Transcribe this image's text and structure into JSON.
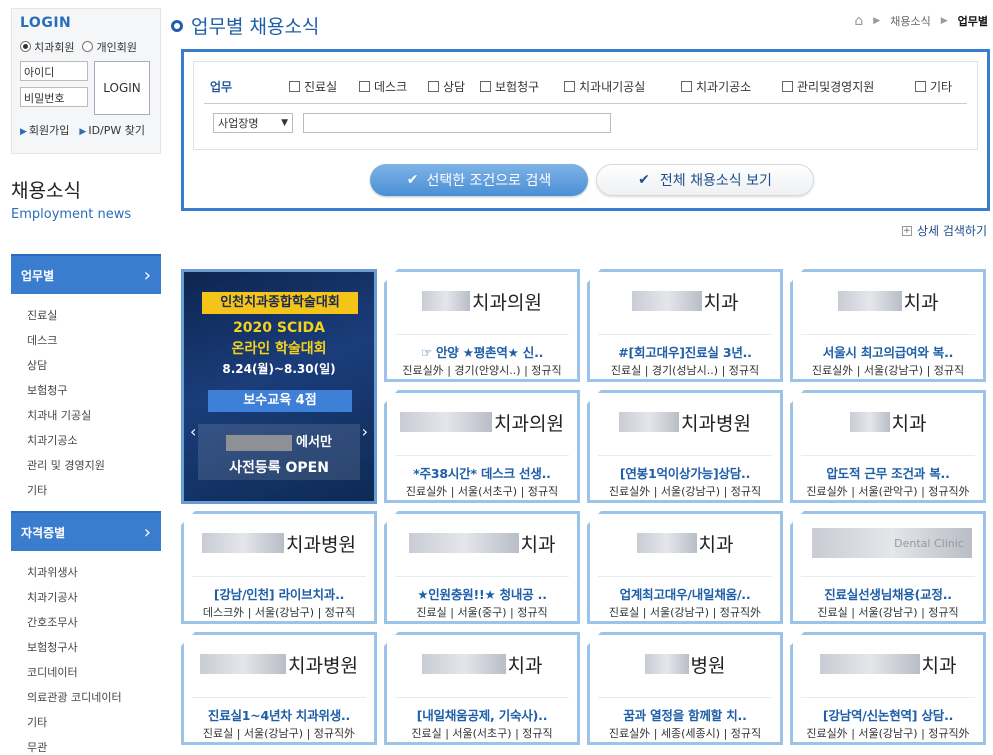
{
  "sidebar": {
    "login_title": "LOGIN",
    "radio_member_dental": "치과회원",
    "radio_member_personal": "개인회원",
    "id_placeholder": "아이디",
    "pw_placeholder": "비밀번호",
    "login_button": "LOGIN",
    "signup_link": "회원가입",
    "find_link": "ID/PW 찾기",
    "section_title": "채용소식",
    "section_subtitle": "Employment news",
    "cat_job_head": "업무별",
    "cat_job_items": [
      "진료실",
      "데스크",
      "상담",
      "보험청구",
      "치과내 기공실",
      "치과기공소",
      "관리 및 경영지원",
      "기타"
    ],
    "cat_license_head": "자격증별",
    "cat_license_items": [
      "치과위생사",
      "치과기공사",
      "간호조무사",
      "보험청구사",
      "코디네이터",
      "의료관광 코디네이터",
      "기타",
      "무관"
    ]
  },
  "header": {
    "title": "업무별 채용소식",
    "breadcrumb": [
      "채용소식",
      "업무별"
    ]
  },
  "search": {
    "job_label": "업무",
    "job_options": [
      "진료실",
      "데스크",
      "상담",
      "보험청구",
      "치과내기공실",
      "치과기공소",
      "관리및경영지원",
      "기타"
    ],
    "select_value": "사업장명",
    "search_button": "선택한 조건으로 검색",
    "all_button": "전체 채용소식 보기",
    "detail_link": "상세 검색하기"
  },
  "banner": {
    "top_label": "인천치과종합학술대회",
    "line1": "2020 SCIDA",
    "line2": "온라인 학술대회",
    "dates": "8.24(월)~8.30(일)",
    "edu": "보수교육 4점",
    "reg_suffix": "에서만",
    "reg_line2": "사전등록 OPEN"
  },
  "cards": [
    {
      "logo_text": "치과의원",
      "title": "☞ 안양 ★평촌역★ 신..",
      "meta": "진료실外 | 경기(안양시..) | 정규직"
    },
    {
      "logo_text": "치과",
      "title": "#[회고대우]진료실 3년..",
      "meta": "진료실 | 경기(성남시..) | 정규직"
    },
    {
      "logo_text": "치과",
      "title": "서울시 최고의급여와 복..",
      "meta": "진료실外 | 서울(강남구) | 정규직"
    },
    {
      "logo_text": "치과의원",
      "title": "*주38시간* 데스크 선생..",
      "meta": "진료실外 | 서울(서초구) | 정규직"
    },
    {
      "logo_text": "치과병원",
      "title": "[연봉1억이상가능]상담..",
      "meta": "진료실外 | 서울(강남구) | 정규직"
    },
    {
      "logo_text": "치과",
      "title": "압도적 근무 조건과 복..",
      "meta": "진료실外 | 서울(관악구) | 정규직外"
    },
    {
      "logo_text": "치과병원",
      "title": "[강남/인천] 라이브치과..",
      "meta": "데스크外 | 서울(강남구) | 정규직"
    },
    {
      "logo_text": "치과",
      "title": "★인원충원!!★ 청내공 ..",
      "meta": "진료실 | 서울(중구) | 정규직"
    },
    {
      "logo_text": "치과",
      "title": "업계최고대우/내일채움/..",
      "meta": "진료실 | 서울(강남구) | 정규직外"
    },
    {
      "logo_text": "Dental Clinic",
      "title": "진료실선생님채용(교정..",
      "meta": "진료실 | 서울(강남구) | 정규직"
    },
    {
      "logo_text": "치과병원",
      "title": "진료실1~4년차 치과위생..",
      "meta": "진료실 | 서울(강남구) | 정규직外"
    },
    {
      "logo_text": "치과",
      "title": "[내일채움공제, 기숙사)..",
      "meta": "진료실 | 서울(서초구) | 정규직"
    },
    {
      "logo_text": "병원",
      "title": "꿈과 열정을 함께할 치..",
      "meta": "진료실外 | 세종(세종시) | 정규직"
    },
    {
      "logo_text": "치과",
      "title": "[강남역/신논현역] 상담..",
      "meta": "진료실外 | 서울(강남구) | 정규직外"
    }
  ],
  "colors": {
    "accent": "#3a7dcf",
    "title_blue": "#1f5fa8",
    "card_border": "#9cc3e8"
  }
}
